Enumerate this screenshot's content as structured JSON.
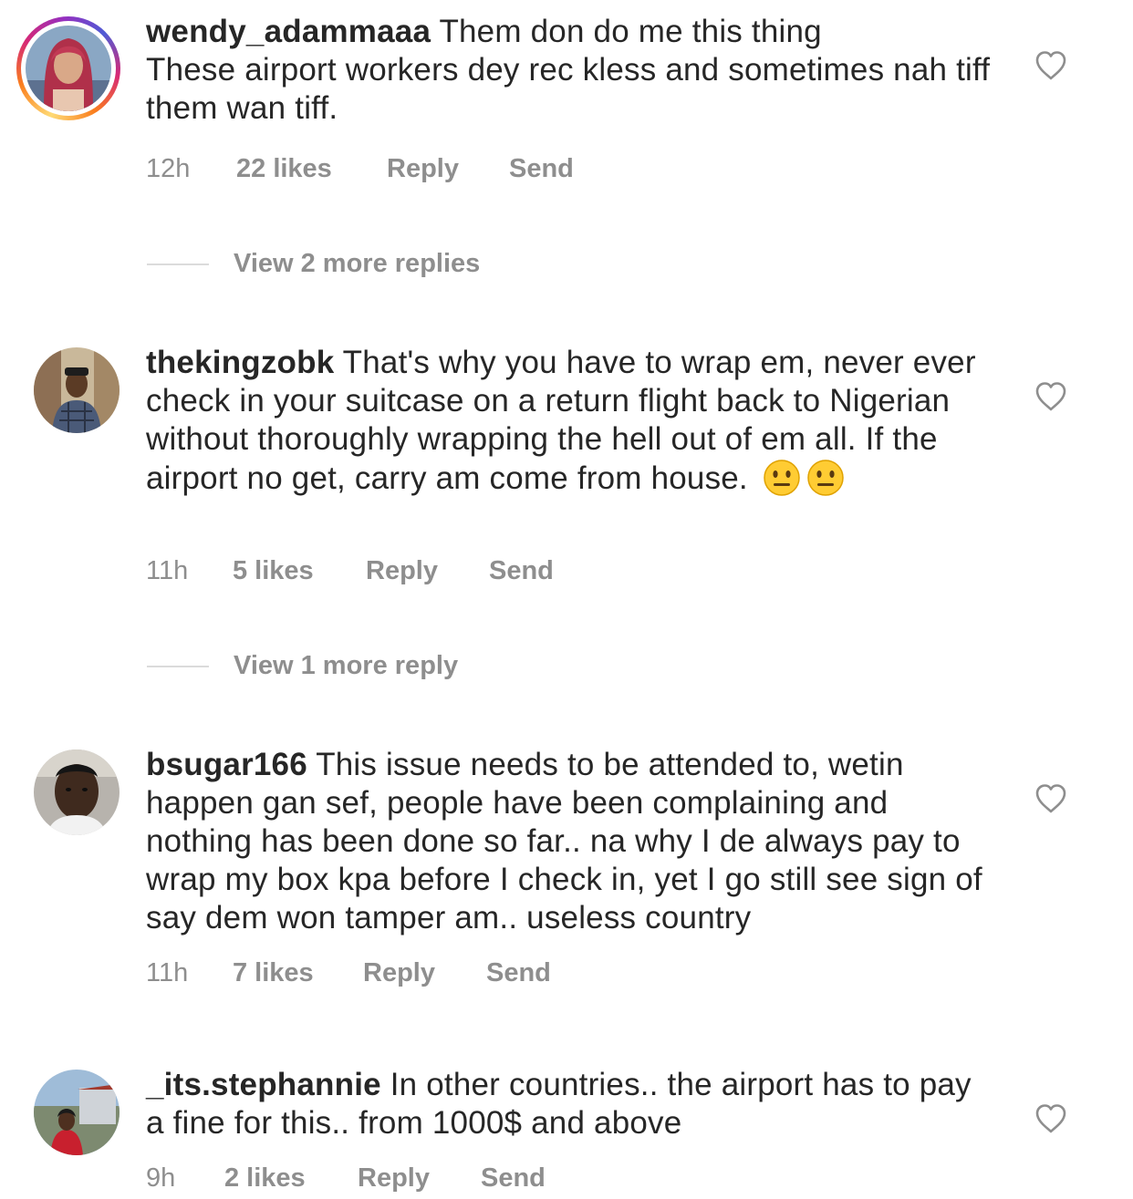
{
  "comments": [
    {
      "username": "wendy_adammaaa",
      "text_first": "Them don do me this thing",
      "text_rest": "These airport workers dey rec kless and sometimes nah tiff them wan tiff.",
      "time": "12h",
      "likes": "22 likes",
      "reply": "Reply",
      "send": "Send",
      "view_replies": "View 2 more replies"
    },
    {
      "username": "thekingzobk",
      "text": "That's why you have to wrap em, never ever check in your suitcase on a return flight back to Nigerian without thoroughly wrapping the hell out of em all. If the airport no get, carry am come from house.",
      "emojis": "neutral-face-emoji x2",
      "time": "11h",
      "likes": "5 likes",
      "reply": "Reply",
      "send": "Send",
      "view_replies": "View 1 more reply"
    },
    {
      "username": "bsugar166",
      "text": "This issue needs to be attended to, wetin happen gan sef, people have been complaining and nothing has been done so far.. na why I de always pay to wrap my box kpa before I check in, yet I go still see sign of say dem won tamper am.. useless country",
      "time": "11h",
      "likes": "7 likes",
      "reply": "Reply",
      "send": "Send"
    },
    {
      "username": "_its.stephannie",
      "text": "In other countries.. the airport has to pay a fine for this.. from 1000$ and above",
      "time": "9h",
      "likes": "2 likes",
      "reply": "Reply",
      "send": "Send"
    }
  ],
  "icons": {
    "like": "heart-outline-icon",
    "story_ring": "story-ring-gradient"
  },
  "colors": {
    "text": "#262626",
    "secondary": "#8e8e8e",
    "divider": "#dbdbdb"
  }
}
